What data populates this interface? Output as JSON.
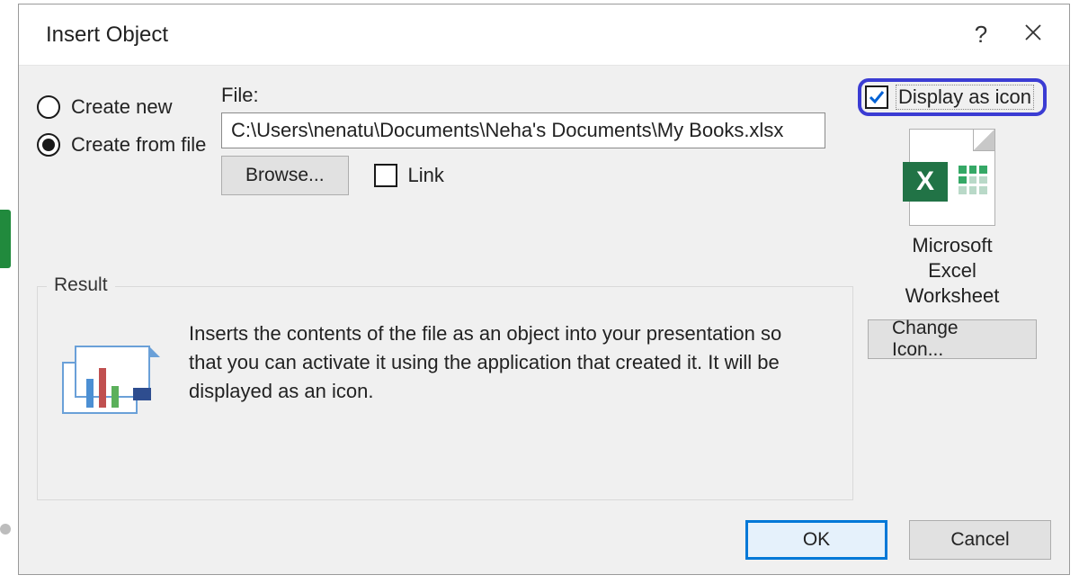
{
  "dialog": {
    "title": "Insert Object",
    "help_char": "?",
    "close_char": "✕"
  },
  "radios": {
    "create_new": "Create new",
    "create_from_file": "Create from file"
  },
  "file": {
    "label": "File:",
    "path": "C:\\Users\\nenatu\\Documents\\Neha's Documents\\My Books.xlsx",
    "browse": "Browse...",
    "link": "Link"
  },
  "display": {
    "label": "Display as icon",
    "icon_letter": "X",
    "caption_line1": "Microsoft",
    "caption_line2": "Excel",
    "caption_line3": "Worksheet",
    "change": "Change Icon..."
  },
  "result": {
    "legend": "Result",
    "text": "Inserts the contents of the file as an object into your presentation so that you can activate it using the application that created it. It will be displayed as an icon."
  },
  "footer": {
    "ok": "OK",
    "cancel": "Cancel"
  }
}
